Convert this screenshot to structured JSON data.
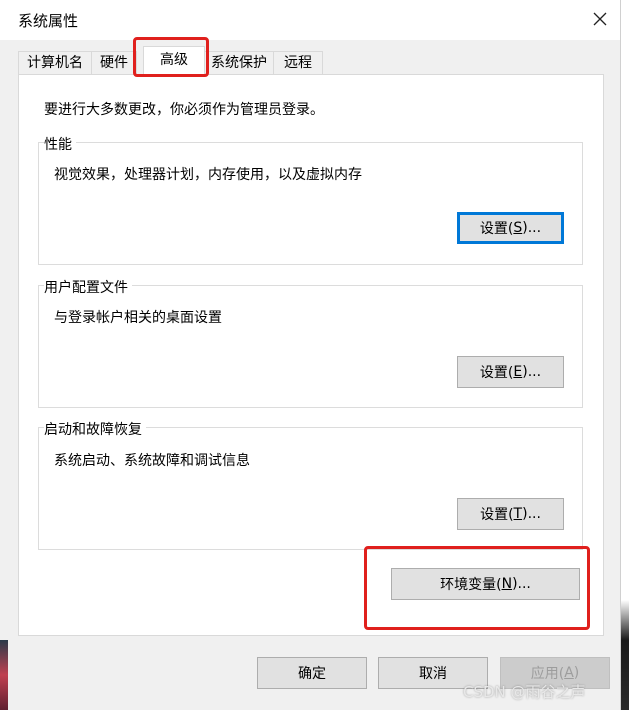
{
  "window": {
    "title": "系统属性"
  },
  "tabs": [
    {
      "label": "计算机名"
    },
    {
      "label": "硬件"
    },
    {
      "label": "高级"
    },
    {
      "label": "系统保护"
    },
    {
      "label": "远程"
    }
  ],
  "active_tab": "高级",
  "advanced": {
    "admin_notice": "要进行大多数更改，你必须作为管理员登录。",
    "performance": {
      "title": "性能",
      "description": "视觉效果，处理器计划，内存使用，以及虚拟内存",
      "button_prefix": "设置(",
      "button_key": "S",
      "button_suffix": ")..."
    },
    "user_profiles": {
      "title": "用户配置文件",
      "description": "与登录帐户相关的桌面设置",
      "button_prefix": "设置(",
      "button_key": "E",
      "button_suffix": ")..."
    },
    "startup_recovery": {
      "title": "启动和故障恢复",
      "description": "系统启动、系统故障和调试信息",
      "button_prefix": "设置(",
      "button_key": "T",
      "button_suffix": ")..."
    },
    "env_vars": {
      "prefix": "环境变量(",
      "key": "N",
      "suffix": ")..."
    }
  },
  "footer": {
    "ok": "确定",
    "cancel": "取消",
    "apply_prefix": "应用(",
    "apply_key": "A",
    "apply_suffix": ")"
  },
  "watermark": "CSDN @雨谷之声",
  "colors": {
    "highlight": "#e0201d",
    "focus": "#0078d7"
  },
  "icons": {
    "close": "close-icon"
  }
}
